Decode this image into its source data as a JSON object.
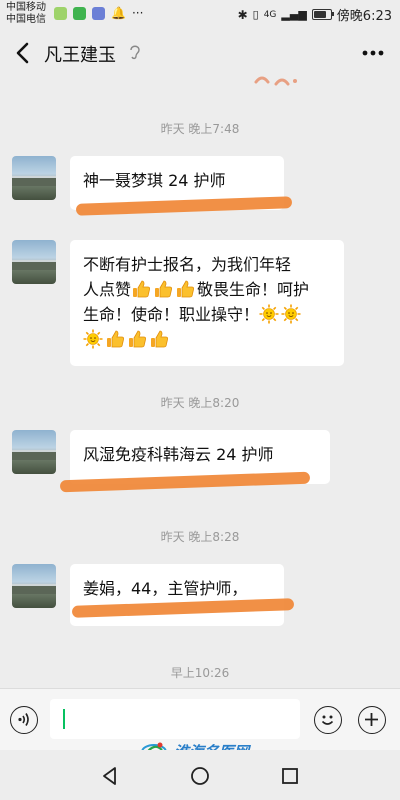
{
  "status_bar": {
    "carrier_1": "中国移动",
    "carrier_2": "中国电信",
    "signal_label": "4G",
    "time": "傍晚6:23",
    "battery_level": 0.75
  },
  "header": {
    "title": "凡王建玉"
  },
  "messages": [
    {
      "type": "timestamp",
      "text": "昨天 晚上7:48"
    },
    {
      "type": "message",
      "lines": [
        "神一聂梦琪 24 护师"
      ]
    },
    {
      "type": "message",
      "lines": [
        "不断有护士报名，为我们年轻",
        "人点赞",
        "敬畏生命！呵护",
        "生命！使命！职业操守！"
      ]
    },
    {
      "type": "timestamp",
      "text": "昨天 晚上8:20"
    },
    {
      "type": "message",
      "lines": [
        "风湿免疫科韩海云  24  护师"
      ]
    },
    {
      "type": "timestamp",
      "text": "昨天 晚上8:28"
    },
    {
      "type": "message",
      "lines": [
        "姜娟，44，主管护师，"
      ]
    },
    {
      "type": "timestamp",
      "text": "早上10:26"
    }
  ],
  "watermark": {
    "text": "淮海名医网"
  },
  "colors": {
    "background": "#ededed",
    "bubble": "#ffffff",
    "redaction": "#f08a3c",
    "caret": "#07c160",
    "timestamp": "#999999"
  },
  "icons": [
    "back-arrow-icon",
    "ear-icon",
    "more-icon",
    "voice-icon",
    "emoji-icon",
    "plus-icon",
    "thumbs-up-icon",
    "sun-face-icon",
    "back-triangle-icon",
    "home-circle-icon",
    "recents-square-icon"
  ]
}
